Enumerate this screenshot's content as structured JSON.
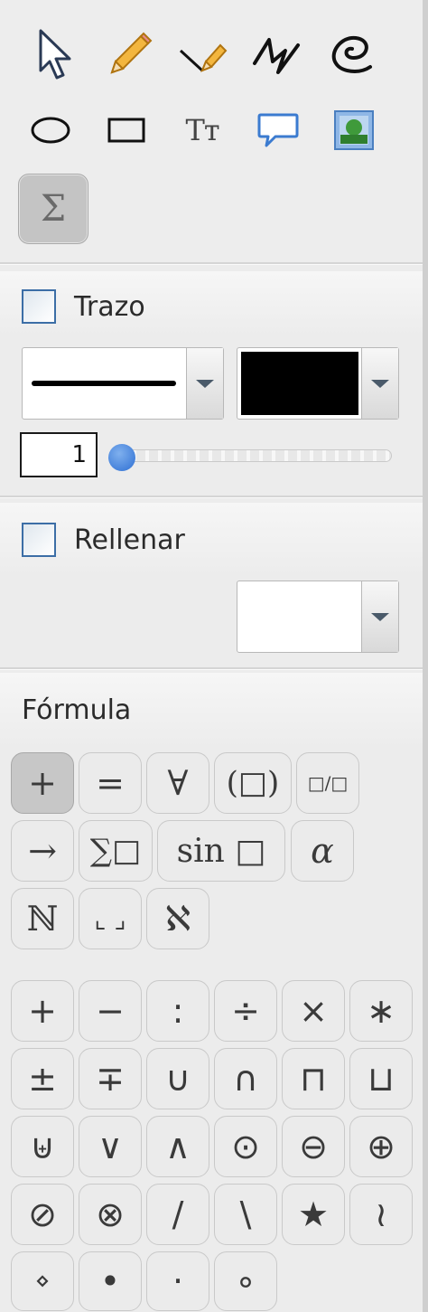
{
  "tools": {
    "row1": [
      {
        "name": "select-icon"
      },
      {
        "name": "pencil-icon"
      },
      {
        "name": "highlighter-icon"
      },
      {
        "name": "freeform-polyline-icon"
      },
      {
        "name": "freehand-curve-icon"
      }
    ],
    "row2": [
      {
        "name": "ellipse-icon"
      },
      {
        "name": "rectangle-icon"
      },
      {
        "name": "text-icon",
        "glyph": "Tт"
      },
      {
        "name": "speech-bubble-icon"
      },
      {
        "name": "image-icon"
      }
    ],
    "row3": [
      {
        "name": "formula-tool",
        "glyph": "Σ",
        "active": true
      }
    ]
  },
  "stroke": {
    "label": "Trazo",
    "width_value": "1",
    "width_slider_level": 0.0,
    "color": "#000000"
  },
  "fill": {
    "label": "Rellenar",
    "color": "#ffffff"
  },
  "formula": {
    "title": "Fórmula",
    "categories": [
      {
        "glyph": "+",
        "active": true
      },
      {
        "glyph": "="
      },
      {
        "glyph": "∀"
      },
      {
        "glyph": "(□)"
      },
      {
        "glyph": "□/□"
      },
      {
        "glyph": "→"
      },
      {
        "glyph": "∑□"
      },
      {
        "glyph": "sin □"
      },
      {
        "glyph": "α"
      },
      {
        "glyph": "ℕ"
      },
      {
        "glyph": "⌞ ⌟"
      },
      {
        "glyph": "ℵ"
      }
    ],
    "symbols": [
      "+",
      "−",
      ":",
      "÷",
      "×",
      "∗",
      "±",
      "∓",
      "∪",
      "∩",
      "⊓",
      "⊔",
      "⊎",
      "∨",
      "∧",
      "⊙",
      "⊖",
      "⊕",
      "⊘",
      "⊗",
      "/",
      "\\",
      "★",
      "≀",
      "⋄",
      "•",
      "·",
      "∘"
    ]
  }
}
